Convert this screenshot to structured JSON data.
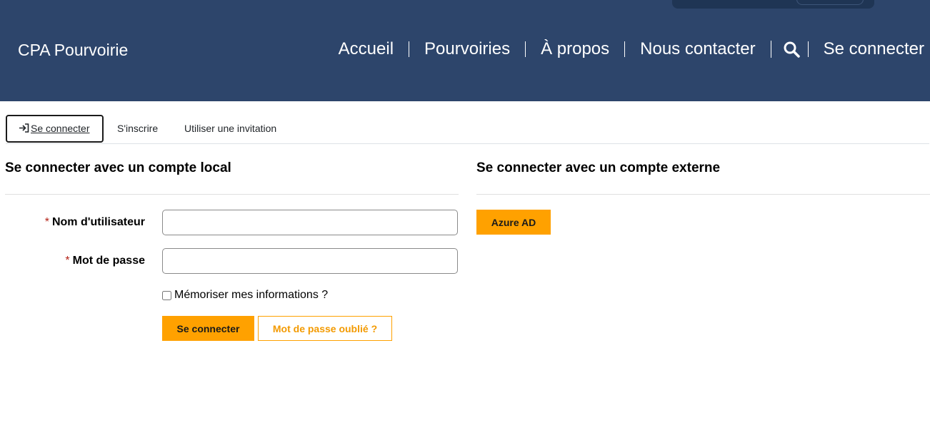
{
  "header": {
    "brand": "CPA Pourvoirie",
    "nav": [
      "Accueil",
      "Pourvoiries",
      "À propos",
      "Nous contacter"
    ],
    "search_icon": "search-icon",
    "login_link": "Se connecter"
  },
  "tabs": [
    {
      "label": "Se connecter",
      "icon": "sign-in-icon",
      "active": true
    },
    {
      "label": "S'inscrire",
      "active": false
    },
    {
      "label": "Utiliser une invitation",
      "active": false
    }
  ],
  "local": {
    "heading": "Se connecter avec un compte local",
    "username_label": "Nom d'utilisateur",
    "username_value": "",
    "password_label": "Mot de passe",
    "password_value": "",
    "required_marker": "*",
    "remember_label": "Mémoriser mes informations ?",
    "remember_checked": false,
    "login_button": "Se connecter",
    "forgot_button": "Mot de passe oublié ?"
  },
  "external": {
    "heading": "Se connecter avec un compte externe",
    "azure_button": "Azure AD"
  },
  "colors": {
    "header_bg": "#2d456b",
    "accent": "#ffa100",
    "required": "#b42318"
  }
}
